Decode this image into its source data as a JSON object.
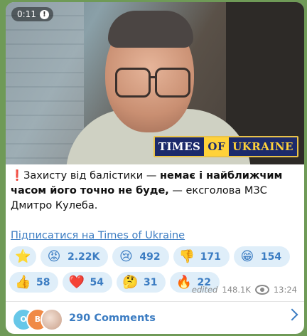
{
  "video": {
    "timer": "0:11",
    "logo": {
      "part1": "TIMES",
      "part2": "OF",
      "part3": "UKRAINE"
    }
  },
  "post": {
    "warn_icon": "❗",
    "text_plain_1": "Захисту від балістики — ",
    "text_bold": "немає і найближчим часом його точно не буде,",
    "text_plain_2": " — ексголова МЗС Дмитро Кулеба.",
    "subscribe_link": "Підписатися на Times of Ukraine"
  },
  "reactions": [
    {
      "icon": "star-icon",
      "emoji": "⭐",
      "count": ""
    },
    {
      "icon": "angry-face-icon",
      "emoji": "😡",
      "count": "2.22K"
    },
    {
      "icon": "crying-face-icon",
      "emoji": "😢",
      "count": "492"
    },
    {
      "icon": "thumbs-down-icon",
      "emoji": "👎",
      "count": "171"
    },
    {
      "icon": "grinning-face-icon",
      "emoji": "😁",
      "count": "154"
    },
    {
      "icon": "thumbs-up-icon",
      "emoji": "👍",
      "count": "58"
    },
    {
      "icon": "heart-icon",
      "emoji": "❤️",
      "count": "54"
    },
    {
      "icon": "thinking-face-icon",
      "emoji": "🤔",
      "count": "31"
    },
    {
      "icon": "fire-icon",
      "emoji": "🔥",
      "count": "22"
    }
  ],
  "meta": {
    "edited": "edited",
    "views": "148.1K",
    "time": "13:24"
  },
  "comments": {
    "avatar1": "O",
    "avatar2": "B",
    "label": "290 Comments"
  }
}
